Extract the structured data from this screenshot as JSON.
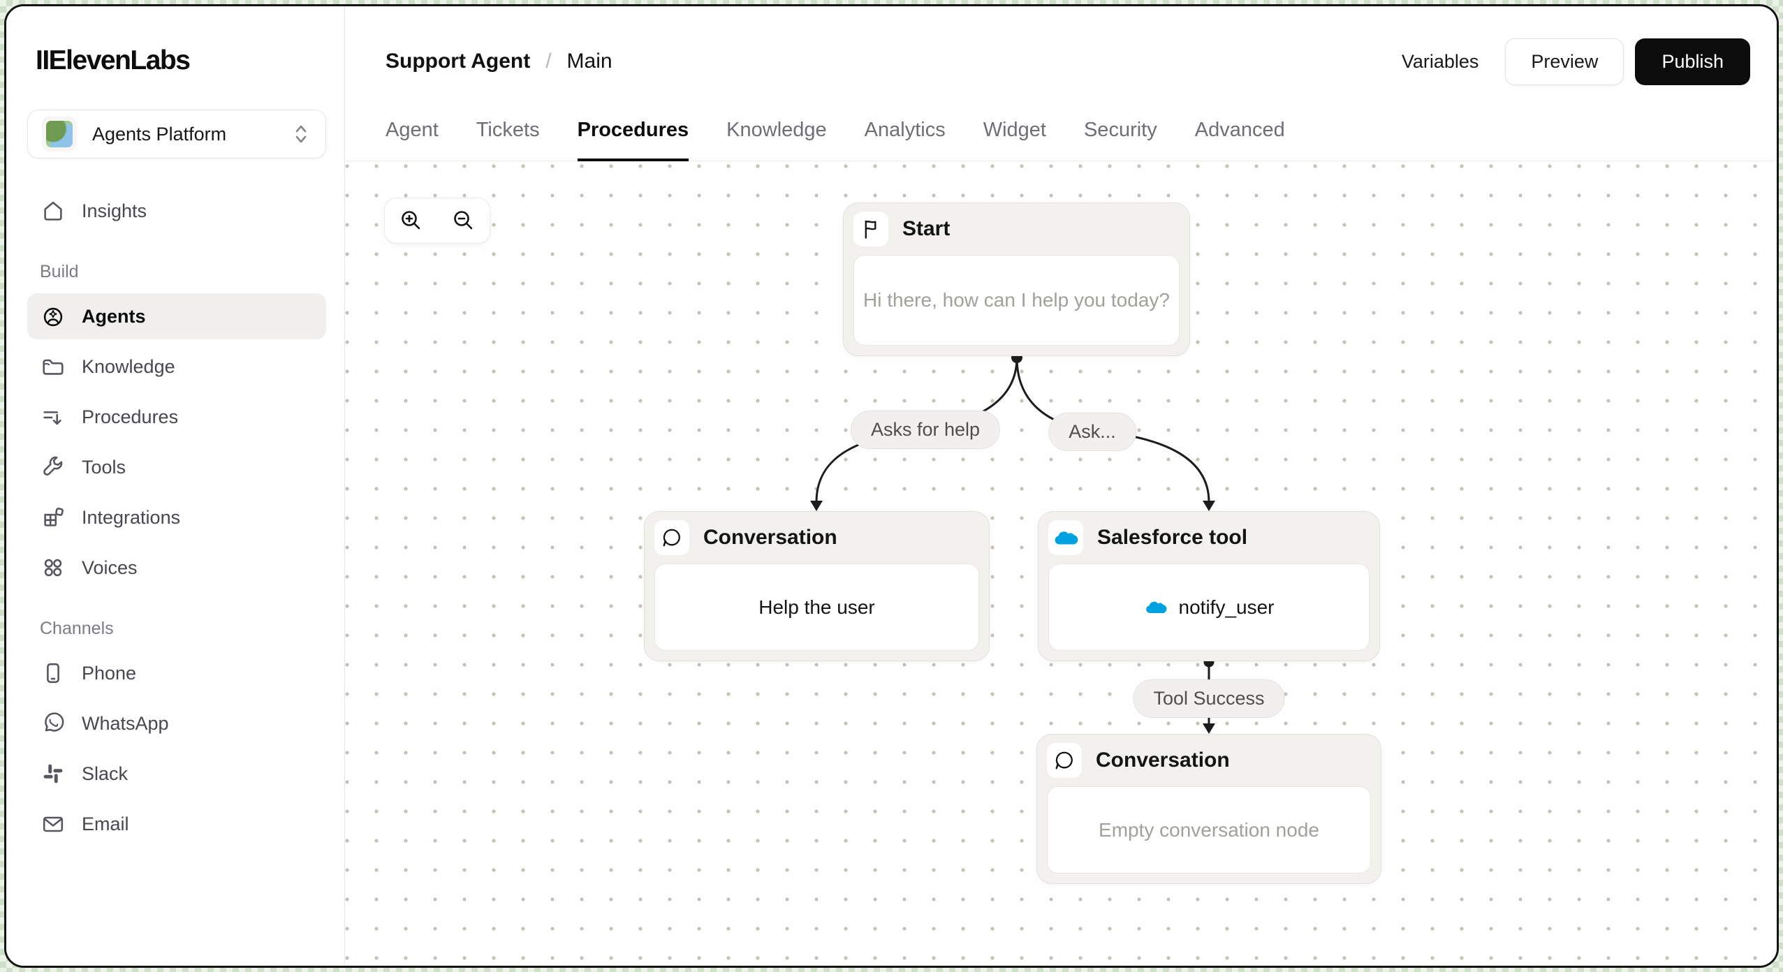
{
  "sidebar": {
    "logo": "IIElevenLabs",
    "workspace": {
      "name": "Agents Platform"
    },
    "nav": {
      "insights": "Insights",
      "build_label": "Build",
      "agents": "Agents",
      "knowledge": "Knowledge",
      "procedures": "Procedures",
      "tools": "Tools",
      "integrations": "Integrations",
      "voices": "Voices",
      "channels_label": "Channels",
      "phone": "Phone",
      "whatsapp": "WhatsApp",
      "slack": "Slack",
      "email": "Email"
    }
  },
  "header": {
    "breadcrumb": {
      "agent": "Support Agent",
      "separator": "/",
      "page": "Main"
    },
    "tabs": {
      "agent": "Agent",
      "tickets": "Tickets",
      "procedures": "Procedures",
      "knowledge": "Knowledge",
      "analytics": "Analytics",
      "widget": "Widget",
      "security": "Security",
      "advanced": "Advanced"
    },
    "active_tab": "Procedures",
    "actions": {
      "variables": "Variables",
      "preview": "Preview",
      "publish": "Publish"
    }
  },
  "canvas": {
    "nodes": {
      "start": {
        "title": "Start",
        "placeholder": "Hi there, how can I help you today?"
      },
      "conversation_left": {
        "title": "Conversation",
        "content": "Help the user"
      },
      "salesforce": {
        "title": "Salesforce tool",
        "tool_name": "notify_user"
      },
      "conversation_bottom": {
        "title": "Conversation",
        "placeholder": "Empty conversation node"
      }
    },
    "edge_labels": {
      "asks_for_help": "Asks for help",
      "ask_truncated": "Ask...",
      "tool_success": "Tool Success"
    }
  },
  "colors": {
    "salesforce_blue": "#00A1E0",
    "publish_bg": "#0c0c0c",
    "canvas_dot": "#c6c1b8"
  }
}
